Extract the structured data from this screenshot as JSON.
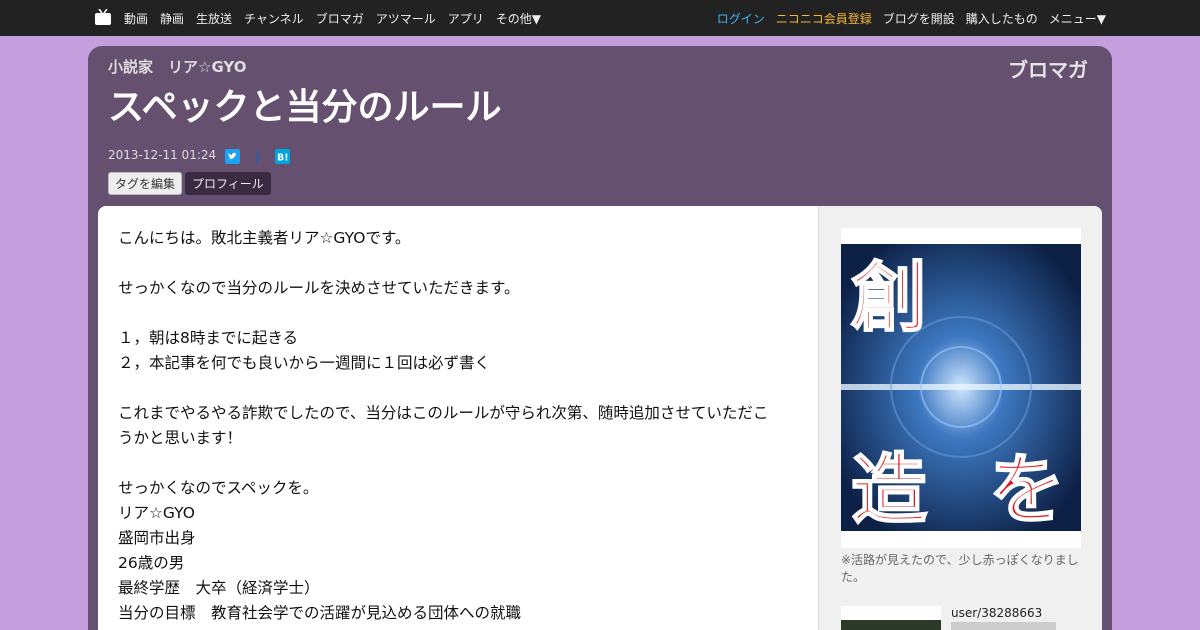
{
  "nav": {
    "left": [
      "動画",
      "静画",
      "生放送",
      "チャンネル",
      "ブロマガ",
      "アツマール",
      "アプリ",
      "その他▼"
    ],
    "login": "ログイン",
    "register": "ニコニコ会員登録",
    "blog": "ブログを開設",
    "purchased": "購入したもの",
    "menu": "メニュー▼"
  },
  "header": {
    "author": "小説家　リア☆GYO",
    "brand": "ブロマガ",
    "title": "スペックと当分のルール",
    "date": "2013-12-11 01:24",
    "tag_button": "タグを編集",
    "profile_button": "プロフィール"
  },
  "article": {
    "paragraphs": [
      "こんにちは。敗北主義者リア☆GYOです。",
      "",
      "せっかくなので当分のルールを決めさせていただきます。",
      "",
      "１，朝は8時までに起きる",
      "２，本記事を何でも良いから一週間に１回は必ず書く",
      "",
      "これまでやるやる詐欺でしたので、当分はこのルールが守られ次第、随時追加させていただこ",
      "うかと思います！",
      "",
      "せっかくなのでスペックを。",
      "リア☆GYO",
      "盛岡市出身",
      "26歳の男",
      "最終学歴　大卒（経済学士）",
      "当分の目標　教育社会学での活躍が見込める団体への就職"
    ]
  },
  "sidebar": {
    "image_text_top": "創",
    "image_text_bottom": "造",
    "image_text_right": "を",
    "caption": "※活路が見えたので、少し赤っぽくなりました。",
    "username": "user/38288663"
  }
}
